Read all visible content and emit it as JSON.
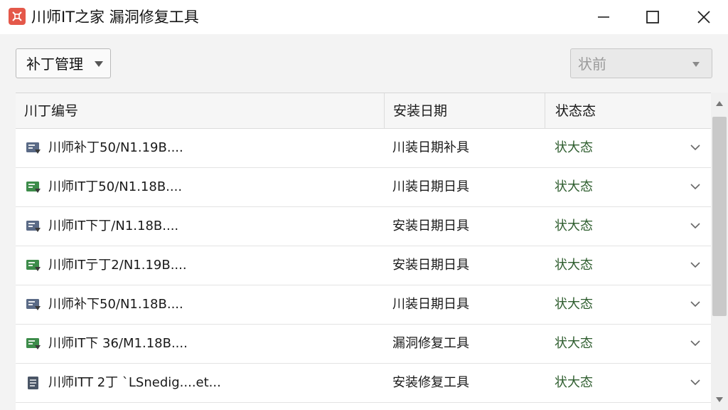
{
  "window": {
    "title": "川师IT之家 漏洞修复工具",
    "icon": "app-logo-icon",
    "controls": [
      "minimize-icon",
      "maximize-icon",
      "close-icon"
    ]
  },
  "toolbar": {
    "patch_menu_label": "补丁管理",
    "status_filter_value": "状前"
  },
  "table": {
    "columns": [
      "川丁编号",
      "安装日期",
      "状态态"
    ],
    "rows": [
      {
        "name": "川师补丁50/N1.19B....",
        "date": "川装日期补具",
        "status": "状大态",
        "icon": "patch-file-icon",
        "icon_color": "#5a6a86"
      },
      {
        "name": "川师IT丁50/N1.18B....",
        "date": "川装日期日具",
        "status": "状大态",
        "icon": "patch-file-icon",
        "icon_color": "#3d8c4a"
      },
      {
        "name": "川师IT下丁/N1.18B....",
        "date": "安装日期日具",
        "status": "状大态",
        "icon": "patch-file-icon",
        "icon_color": "#5a6a86"
      },
      {
        "name": "川师IT亍丁2/N1.19B....",
        "date": "安装日期日具",
        "status": "状大态",
        "icon": "patch-file-icon",
        "icon_color": "#3d8c4a"
      },
      {
        "name": "川师补下50/N1.18B....",
        "date": "川装日期日具",
        "status": "状大态",
        "icon": "patch-file-icon",
        "icon_color": "#5a6a86"
      },
      {
        "name": "川师IT下 36/M1.18B....",
        "date": "漏洞修复工具",
        "status": "状大态",
        "icon": "patch-file-icon",
        "icon_color": "#3d8c4a"
      },
      {
        "name": "川师ITT 2丁  ˋLSnedig....et...",
        "date": "安装修复工具",
        "status": "状大态",
        "icon": "document-icon",
        "icon_color": "#4a5566"
      }
    ]
  },
  "colors": {
    "status_text": "#2e5d2e",
    "app_icon_bg": "#e4584a"
  }
}
